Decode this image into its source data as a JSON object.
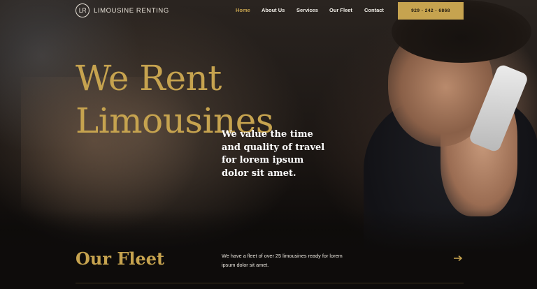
{
  "brand": {
    "monogram": "LR",
    "name": "LIMOUSINE RENTING"
  },
  "nav": {
    "items": [
      {
        "label": "Home",
        "active": true
      },
      {
        "label": "About Us",
        "active": false
      },
      {
        "label": "Services",
        "active": false
      },
      {
        "label": "Our Fleet",
        "active": false
      },
      {
        "label": "Contact",
        "active": false
      }
    ],
    "phone": "929 - 242 - 6868"
  },
  "hero": {
    "headline_line1": "We Rent",
    "headline_line2": "Limousines",
    "tagline": "We value the time and quality of travel for lorem ipsum dolor sit amet."
  },
  "fleet": {
    "title": "Our Fleet",
    "description": "We have a fleet of over 25 limousines ready for lorem ipsum dolor sit amet.",
    "arrow_icon": "arrow-right-icon"
  },
  "colors": {
    "accent": "#c6a34f",
    "background": "#0d0b0a",
    "text": "#ffffff"
  }
}
